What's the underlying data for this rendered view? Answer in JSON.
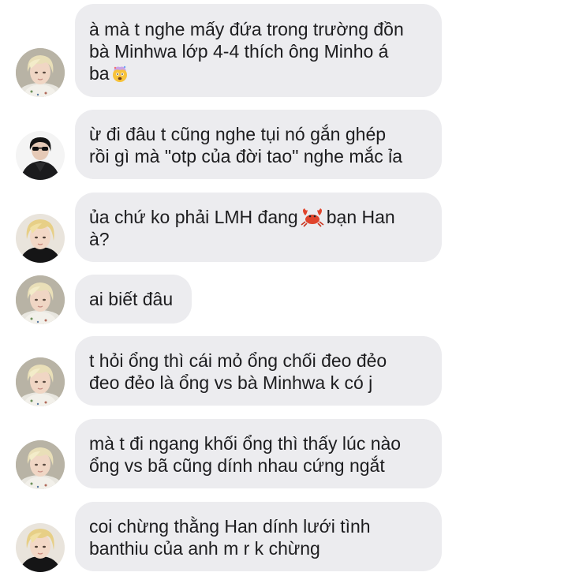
{
  "conversation": {
    "messages": [
      {
        "avatar": "blonde-boy-avatar",
        "lines": [
          "à mà t nghe mấy đứa trong trường đồn",
          "bà Minhwa lớp 4-4 thích ông Minho á",
          "ba"
        ],
        "trailing_emoji": "exploding-head-emoji"
      },
      {
        "avatar": "dark-haired-boy-avatar",
        "lines": [
          "ừ đi đâu t cũng nghe tụi nó gắn ghép",
          "rồi gì mà \"otp của đời tao\" nghe mắc ỉa"
        ]
      },
      {
        "avatar": "blonde-boy-black-shirt-avatar",
        "lines_before": "ủa chứ ko phải LMH đang",
        "inline_emoji": "crab-emoji",
        "lines_after": "bạn Han",
        "lines": [
          "à?"
        ]
      },
      {
        "avatar": "blonde-boy-avatar",
        "lines": [
          "ai biết đâu"
        ]
      },
      {
        "avatar": "blonde-boy-avatar",
        "lines": [
          "t hỏi ổng thì cái mỏ ổng chối đeo đẻo",
          "đeo đẻo là ổng vs bà Minhwa k có j"
        ]
      },
      {
        "avatar": "blonde-boy-avatar",
        "lines": [
          "mà t đi ngang khối ổng thì thấy lúc nào",
          "ổng vs bã cũng dính nhau cứng ngắt"
        ]
      },
      {
        "avatar": "blonde-boy-black-shirt-avatar",
        "lines": [
          "coi chừng thằng Han dính lưới tình",
          "banthiu của anh m r k chừng"
        ]
      }
    ]
  },
  "colors": {
    "bubble": "#ececef",
    "text": "#1d1d1f",
    "background": "#ffffff"
  }
}
